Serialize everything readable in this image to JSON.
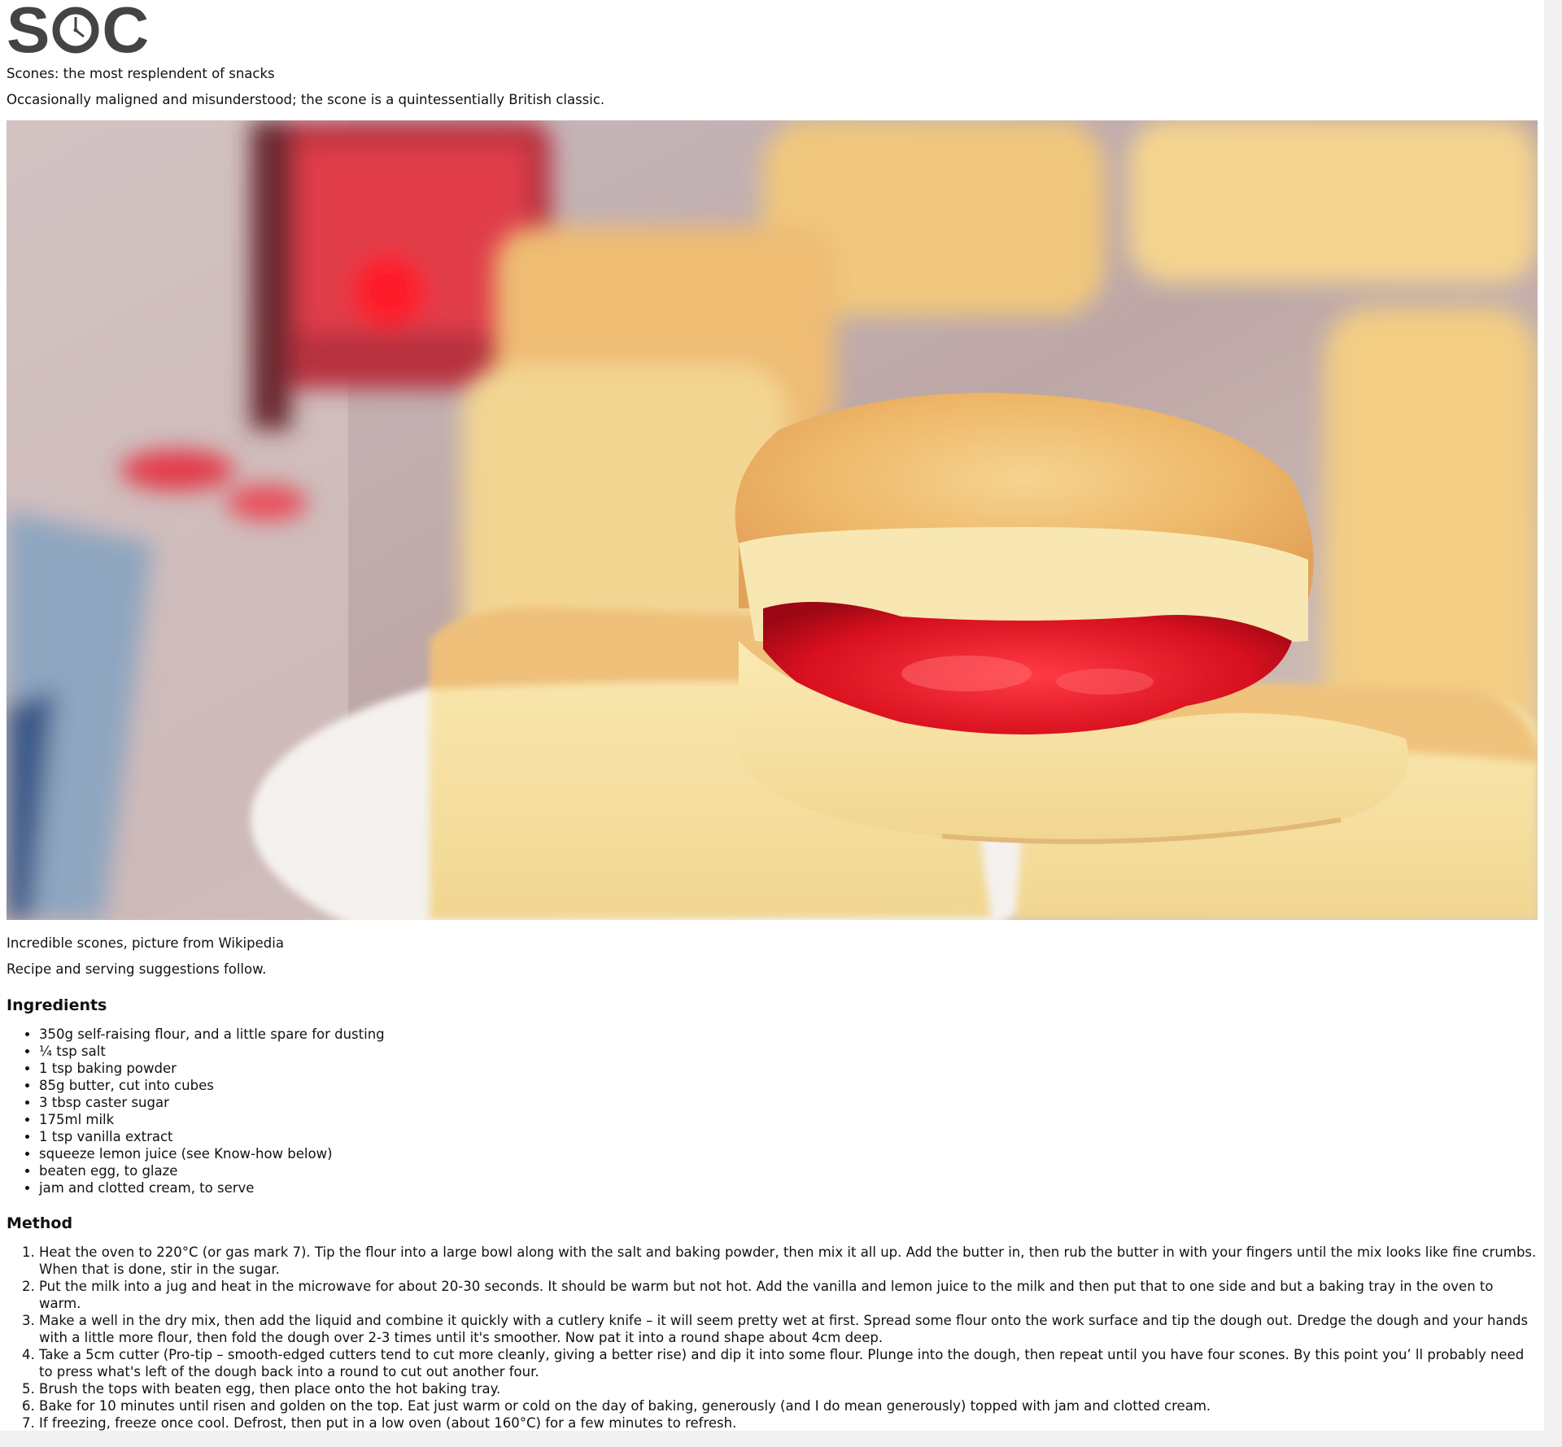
{
  "site": {
    "logo_text_left": "S",
    "logo_text_right": "C"
  },
  "intro": {
    "tagline": "Scones: the most resplendent of snacks",
    "subtitle": "Occasionally maligned and misunderstood; the scone is a quintessentially British classic."
  },
  "hero_image": {
    "caption": "Incredible scones, picture from Wikipedia"
  },
  "lead": "Recipe and serving suggestions follow.",
  "ingredients": {
    "heading": "Ingredients",
    "items": [
      "350g self-raising flour, and a little spare for dusting",
      "¼ tsp salt",
      "1 tsp baking powder",
      "85g butter, cut into cubes",
      "3 tbsp caster sugar",
      "175ml milk",
      "1 tsp vanilla extract",
      "squeeze lemon juice (see Know-how below)",
      "beaten egg, to glaze",
      "jam and clotted cream, to serve"
    ]
  },
  "method": {
    "heading": "Method",
    "steps": [
      "Heat the oven to 220°C (or gas mark 7). Tip the flour into a large bowl along with the salt and baking powder, then mix it all up. Add the butter in, then rub the butter in with your fingers until the mix looks like fine crumbs. When that is done, stir in the sugar.",
      "Put the milk into a jug and heat in the microwave for about 20-30 seconds. It should be warm but not hot. Add the vanilla and lemon juice to the milk and then put that to one side and but a baking tray in the oven to warm.",
      "Make a well in the dry mix, then add the liquid and combine it quickly with a cutlery knife – it will seem pretty wet at first. Spread some flour onto the work surface and tip the dough out. Dredge the dough and your hands with a little more flour, then fold the dough over 2-3 times until it's smoother. Now pat it into a round shape about 4cm deep.",
      "Take a 5cm cutter (Pro-tip – smooth-edged cutters tend to cut more cleanly, giving a better rise) and dip it into some flour. Plunge into the dough, then repeat until you have four scones. By this point you’ ll probably need to press what's left of the dough back into a round to cut out another four.",
      "Brush the tops with beaten egg, then place onto the hot baking tray.",
      "Bake for 10 minutes until risen and golden on the top. Eat just warm or cold on the day of baking, generously (and I do mean generously) topped with jam and clotted cream.",
      "If freezing, freeze once cool. Defrost, then put in a low oven (about 160°C) for a few minutes to refresh."
    ]
  },
  "colors": {
    "logo": "#444444",
    "jam": "#d3102a",
    "scone": "#f3d98e"
  }
}
